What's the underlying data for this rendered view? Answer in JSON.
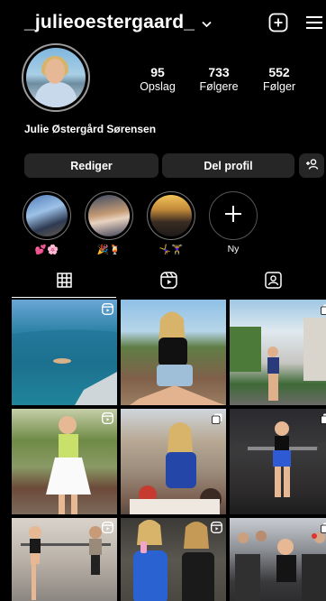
{
  "header": {
    "username": "_julieoestergaard_",
    "add_icon": "plus-square-icon",
    "menu_icon": "hamburger-menu-icon"
  },
  "profile": {
    "stats": {
      "posts": {
        "value": "95",
        "label": "Opslag"
      },
      "followers": {
        "value": "733",
        "label": "Følgere"
      },
      "following": {
        "value": "552",
        "label": "Følger"
      }
    },
    "full_name": "Julie Østergård Sørensen"
  },
  "actions": {
    "edit_label": "Rediger",
    "share_label": "Del profil",
    "add_person_icon": "add-person-icon"
  },
  "highlights": [
    {
      "label": "💕🌸"
    },
    {
      "label": "🎉🍹"
    },
    {
      "label": "🤸‍♀️🏋️‍♀️"
    },
    {
      "label": "Ny"
    }
  ],
  "tabs": [
    {
      "name": "grid",
      "icon": "grid-icon",
      "active": true
    },
    {
      "name": "reels",
      "icon": "reels-icon",
      "active": false
    },
    {
      "name": "tagged",
      "icon": "tagged-person-icon",
      "active": false
    }
  ],
  "posts": [
    {
      "badge": "reel"
    },
    {
      "badge": ""
    },
    {
      "badge": "multi"
    },
    {
      "badge": "reel"
    },
    {
      "badge": "multi"
    },
    {
      "badge": "multi"
    },
    {
      "badge": "reel"
    },
    {
      "badge": "reel"
    },
    {
      "badge": "multi"
    }
  ],
  "colors": {
    "background": "#000000",
    "button_bg": "#262626",
    "text": "#ffffff"
  }
}
